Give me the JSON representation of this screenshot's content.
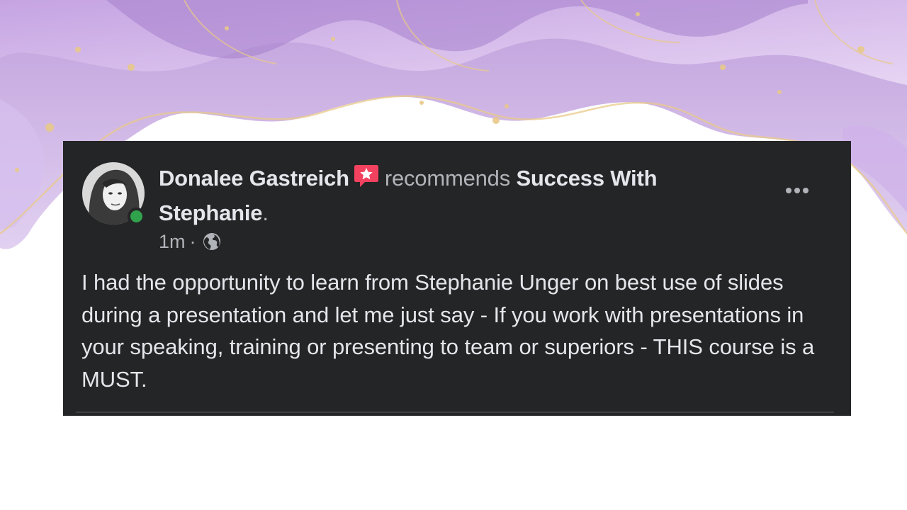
{
  "post": {
    "author_name": "Donalee Gastreich",
    "recommends_text": "recommends",
    "page_name_line1": "Success With",
    "page_name_line2": "Stephanie",
    "period": ".",
    "time": "1m",
    "separator": "·",
    "privacy_icon": "globe-icon",
    "more_icon": "more-options-icon",
    "badge_icon": "recommendation-star-icon",
    "body": "I had the opportunity to learn from Stephanie Unger on best use of slides during a presentation and let me just say - If you work with presentations in your speaking, training or presenting to team or superiors - THIS course is a MUST."
  },
  "colors": {
    "card_background": "#242526",
    "primary_text": "#e4e6eb",
    "secondary_text": "#b0b3b8",
    "online_green": "#31a24c",
    "badge_red": "#f3425f",
    "decor_lavender": "#c9a7e0",
    "decor_gold": "#e8c98a"
  }
}
